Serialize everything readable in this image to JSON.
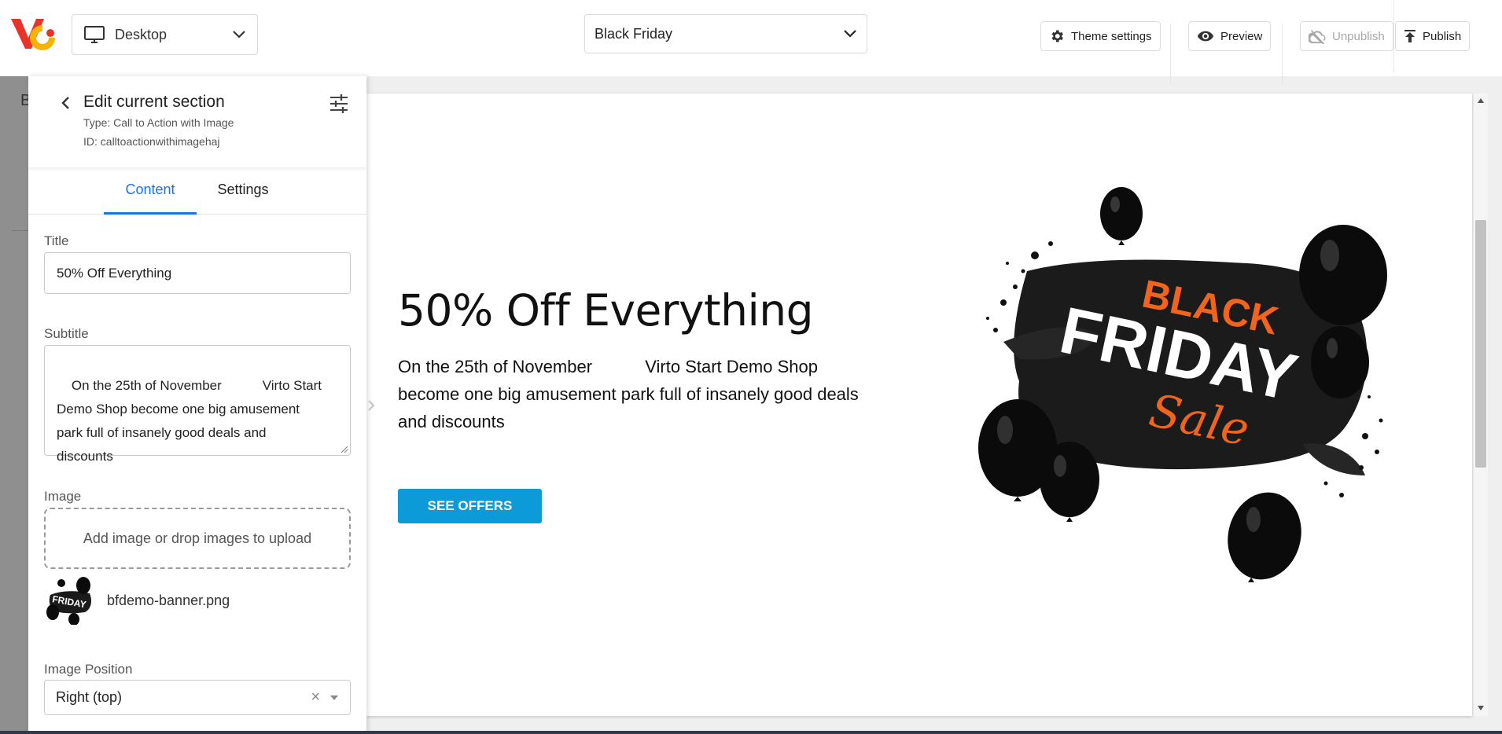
{
  "topbar": {
    "device": "Desktop",
    "page": "Black Friday",
    "theme_settings": "Theme settings",
    "preview": "Preview",
    "unpublish": "Unpublish",
    "publish": "Publish"
  },
  "background": {
    "letter": "B"
  },
  "panel": {
    "title": "Edit current section",
    "type": "Type: Call to Action with Image",
    "id": "ID: calltoactionwithimagehaj",
    "tabs": [
      "Content",
      "Settings"
    ],
    "active_tab": "Content",
    "fields": {
      "title_label": "Title",
      "title_value": "50% Off Everything",
      "subtitle_label": "Subtitle",
      "subtitle_value": "On the 25th of November           Virto Start\nDemo Shop become one big amusement\npark full of insanely good deals and\ndiscounts",
      "image_label": "Image",
      "dropzone": "Add image or drop images to upload",
      "image_file": "bfdemo-banner.png",
      "thumb_text": "FRIDAY",
      "image_position_label": "Image Position",
      "image_position_value": "Right (top)"
    }
  },
  "preview": {
    "title": "50% Off Everything",
    "subtitle": "On the 25th of November           Virto Start Demo Shop\nbecome one big amusement park full of insanely good deals\nand discounts",
    "button": "SEE OFFERS",
    "banner": {
      "line1": "BLACK",
      "line2": "FRIDAY",
      "line3": "Sale"
    }
  },
  "colors": {
    "accent": "#1a73e8",
    "cta": "#0d9ad9",
    "banner_orange": "#f0641e",
    "logo_red": "#e8332a",
    "logo_yellow": "#f5b400"
  }
}
